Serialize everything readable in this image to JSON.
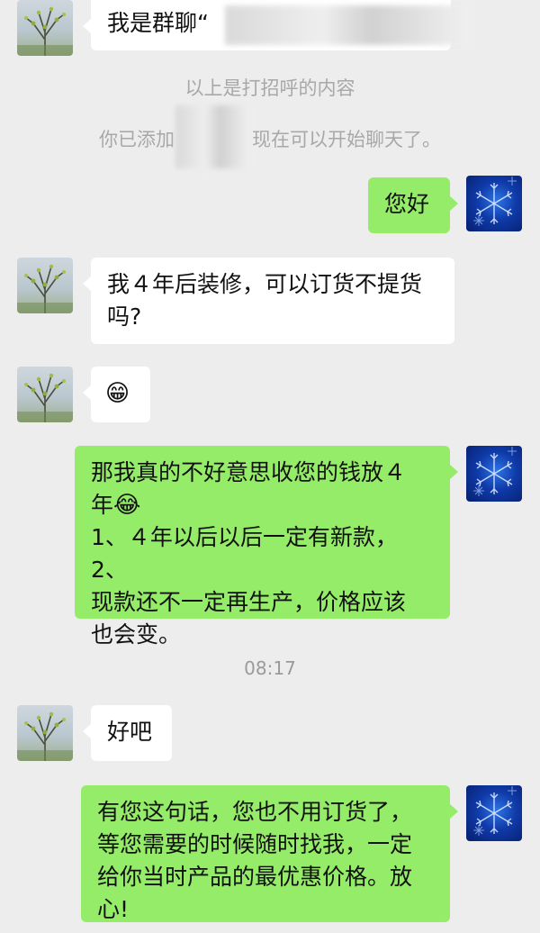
{
  "messages": {
    "m1_text": "我是群聊“",
    "greeting_hint": "以上是打招呼的内容",
    "added_prefix": "你已添加",
    "added_suffix": "现在可以开始聊天了。",
    "m2_text": "您好",
    "m3_line1": "我４年后装修，可以订货不提货",
    "m3_line2": "吗?",
    "m4_emoji": "😁",
    "m5_line1": "那我真的不好意思收您的钱放４",
    "m5_line2": "年",
    "m5_emoji": "😂",
    "m5_line3": "1、４年以后以后一定有新款，2、",
    "m5_line4": "现款还不一定再生产，价格应该",
    "m5_line5": "也会变。",
    "time_label": "08:17",
    "m6_text": "好吧",
    "m7_line1": "有您这句话，您也不用订货了，",
    "m7_line2": "等您需要的时候随时找我，一定",
    "m7_line3": "给你当时产品的最优惠价格。放",
    "m7_line4": "心!"
  },
  "colors": {
    "background": "#ededed",
    "incoming_bubble": "#ffffff",
    "outgoing_bubble": "#95ec69",
    "system_text": "#a8a8a8"
  },
  "icons": {
    "contact_avatar": "plant-branch-avatar",
    "own_avatar": "snowflake-avatar"
  }
}
